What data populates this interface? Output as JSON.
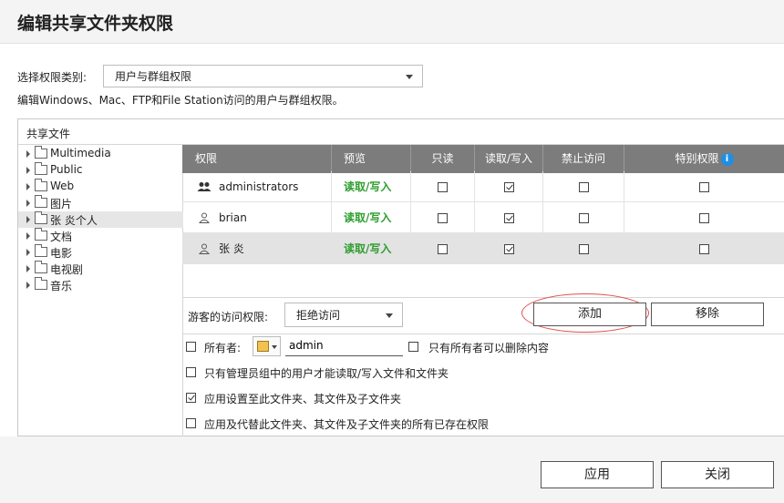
{
  "dialog": {
    "title": "编辑共享文件夹权限"
  },
  "permission_type": {
    "label": "选择权限类别:",
    "selected": "用户与群组权限"
  },
  "description": "编辑Windows、Mac、FTP和File Station访问的用户与群组权限。",
  "panel": {
    "header": "共享文件"
  },
  "tree": {
    "items": [
      {
        "label": "Multimedia",
        "selected": false
      },
      {
        "label": "Public",
        "selected": false
      },
      {
        "label": "Web",
        "selected": false
      },
      {
        "label": "图片",
        "selected": false
      },
      {
        "label": "张 炎个人",
        "selected": true
      },
      {
        "label": "文档",
        "selected": false
      },
      {
        "label": "电影",
        "selected": false
      },
      {
        "label": "电视剧",
        "selected": false
      },
      {
        "label": "音乐",
        "selected": false
      }
    ]
  },
  "table": {
    "headers": {
      "permission": "权限",
      "preview": "预览",
      "read_only": "只读",
      "read_write": "读取/写入",
      "deny": "禁止访问",
      "special": "特别权限"
    },
    "rows": [
      {
        "name": "administrators",
        "type": "group-icon",
        "preview": "读取/写入",
        "read_only": false,
        "read_write": true,
        "deny": false,
        "special": false
      },
      {
        "name": "brian",
        "type": "user-icon",
        "preview": "读取/写入",
        "read_only": false,
        "read_write": true,
        "deny": false,
        "special": false
      },
      {
        "name": "张 炎",
        "type": "user-icon",
        "preview": "读取/写入",
        "read_only": false,
        "read_write": true,
        "deny": false,
        "special": false
      }
    ]
  },
  "guest": {
    "label": "游客的访问权限:",
    "selected": "拒绝访问"
  },
  "buttons": {
    "add": "添加",
    "remove": "移除",
    "apply": "应用",
    "close": "关闭"
  },
  "owner": {
    "label": "所有者:",
    "value": "admin",
    "only_owner_delete": "只有所有者可以删除内容"
  },
  "options": {
    "admin_only": "只有管理员组中的用户才能读取/写入文件和文件夹",
    "apply_to_sub": "应用设置至此文件夹、其文件及子文件夹",
    "apply_replace": "应用及代替此文件夹、其文件及子文件夹的所有已存在权限"
  },
  "checkbox_states": {
    "owner": false,
    "only_owner_delete": false,
    "admin_only": false,
    "apply_to_sub": true,
    "apply_replace": false
  },
  "colors": {
    "header_bg": "#7c7c7c",
    "preview_green": "#2f9e2f",
    "info_blue": "#1f8fe5",
    "highlight_red": "#e05050"
  }
}
